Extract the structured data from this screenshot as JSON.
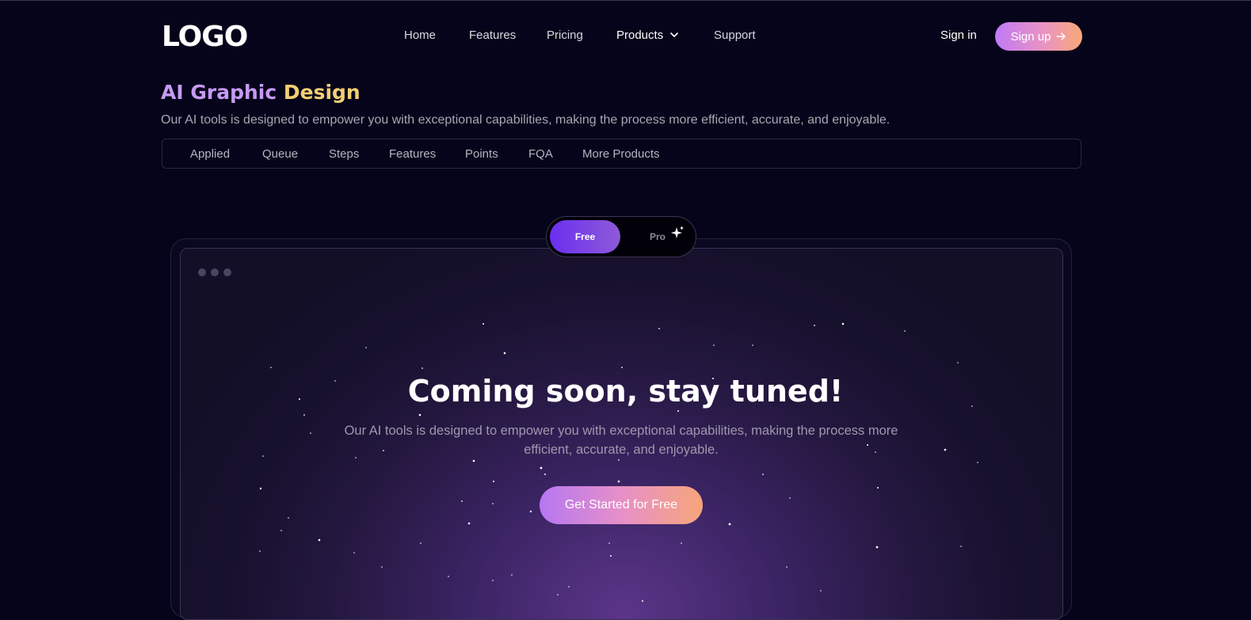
{
  "header": {
    "logo": "LOGO",
    "nav": [
      {
        "label": "Home"
      },
      {
        "label": "Features"
      },
      {
        "label": "Pricing"
      },
      {
        "label": "Products"
      },
      {
        "label": "Support"
      }
    ],
    "sign_in": "Sign in",
    "sign_up": "Sign up"
  },
  "page": {
    "title_part1": "AI Graphic",
    "title_part2": "Design",
    "subtitle": "Our AI tools is designed to empower you with exceptional capabilities, making the process more efficient, accurate, and enjoyable.",
    "tabs": [
      "Applied",
      "Queue",
      "Steps",
      "Features",
      "Points",
      "FQA",
      "More Products"
    ]
  },
  "plan_toggle": {
    "free": "Free",
    "pro": "Pro",
    "selected": "Free"
  },
  "hero": {
    "title": "Coming soon, stay tuned!",
    "description": "Our AI tools is designed to empower you with exceptional capabilities, making the process more efficient, accurate, and enjoyable.",
    "cta": "Get Started for Free"
  },
  "colors": {
    "background": "#06041a",
    "title_purple": "#c79af5",
    "title_yellow": "#f4cf72",
    "toggle_active": "#6a2ff0",
    "gradient_start": "#c07af5",
    "gradient_end": "#f8a877"
  }
}
